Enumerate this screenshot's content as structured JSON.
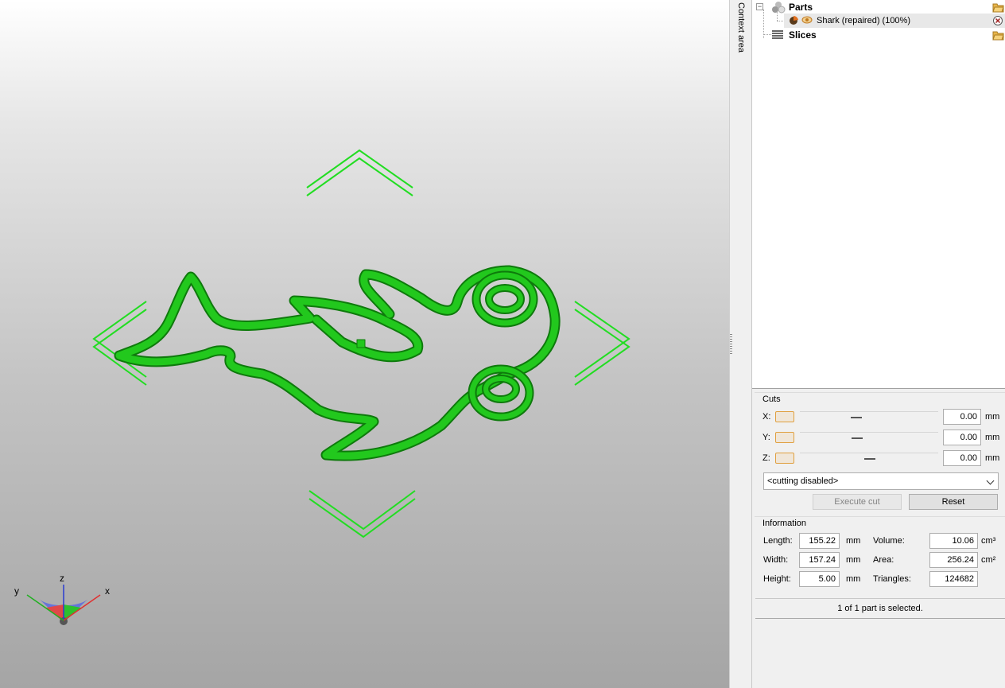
{
  "viewport": {
    "model_color": "#1fba1a",
    "arrow_color": "#22dd22",
    "axis_labels": {
      "x": "x",
      "y": "y",
      "z": "z"
    }
  },
  "context_tab": {
    "label": "Context area"
  },
  "tree": {
    "parts": {
      "label": "Parts"
    },
    "part_item": {
      "label": "Shark (repaired) (100%)"
    },
    "slices": {
      "label": "Slices"
    }
  },
  "cuts": {
    "title": "Cuts",
    "x": {
      "label": "X:",
      "value": "0.00",
      "unit": "mm"
    },
    "y": {
      "label": "Y:",
      "value": "0.00",
      "unit": "mm"
    },
    "z": {
      "label": "Z:",
      "value": "0.00",
      "unit": "mm"
    },
    "mode": "<cutting disabled>",
    "execute_label": "Execute cut",
    "reset_label": "Reset"
  },
  "information": {
    "title": "Information",
    "length": {
      "label": "Length:",
      "value": "155.22",
      "unit": "mm"
    },
    "width": {
      "label": "Width:",
      "value": "157.24",
      "unit": "mm"
    },
    "height": {
      "label": "Height:",
      "value": "5.00",
      "unit": "mm"
    },
    "volume": {
      "label": "Volume:",
      "value": "10.06",
      "unit": "cm³"
    },
    "area": {
      "label": "Area:",
      "value": "256.24",
      "unit": "cm²"
    },
    "triangles": {
      "label": "Triangles:",
      "value": "124682"
    }
  },
  "status": {
    "text": "1 of 1 part is selected."
  }
}
